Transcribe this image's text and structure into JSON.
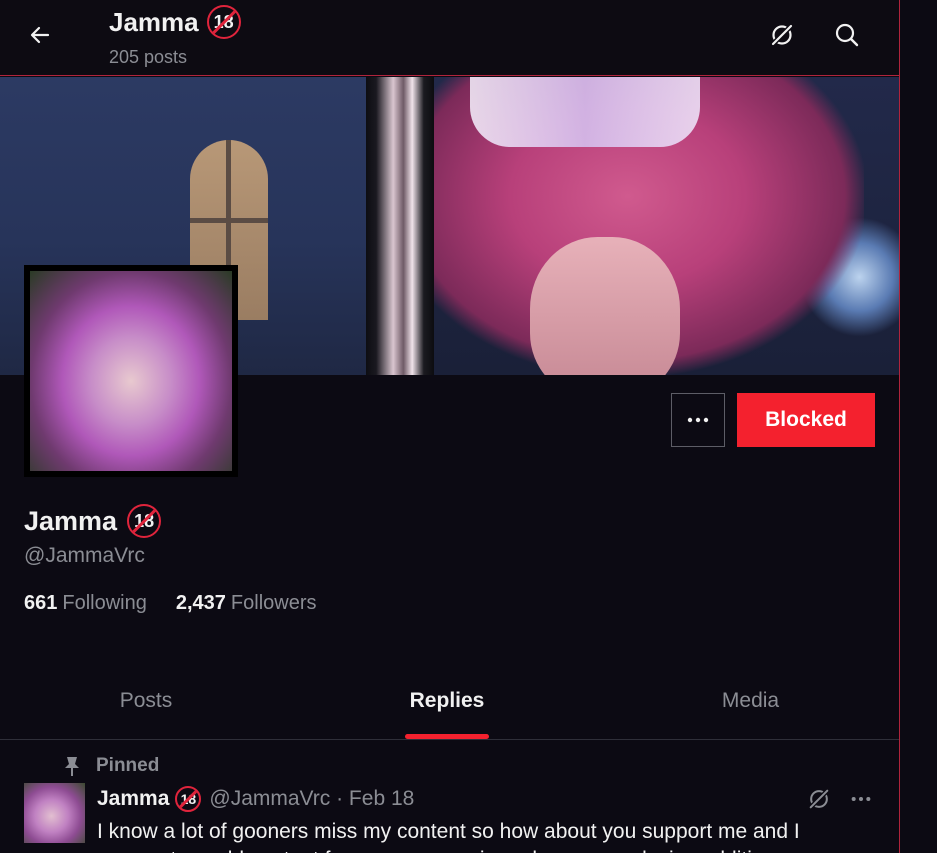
{
  "header": {
    "title": "Jamma",
    "badge": "18",
    "post_count": "205 posts",
    "icons": [
      "arrow-left-icon",
      "grok-icon",
      "search-icon"
    ]
  },
  "profile": {
    "name": "Jamma",
    "badge": "18",
    "handle": "@JammaVrc",
    "following_count": "661",
    "following_label": "Following",
    "followers_count": "2,437",
    "followers_label": "Followers",
    "blocked_label": "Blocked"
  },
  "tabs": [
    {
      "label": "Posts"
    },
    {
      "label": "Replies",
      "active": true
    },
    {
      "label": "Media"
    }
  ],
  "pinned_post": {
    "pinned_label": "Pinned",
    "author": "Jamma",
    "badge": "18",
    "handle_date": "@JammaVrc · Feb 18",
    "text_line1": "I know a lot of gooners miss my content so how about you support me and I",
    "text_line2": "can post my old content for you guys again and a new, exclusive additions"
  },
  "colors": {
    "accent": "#f4212e",
    "border": "#b0243c",
    "background": "#0c0a13",
    "muted_text": "#8b8d94"
  }
}
